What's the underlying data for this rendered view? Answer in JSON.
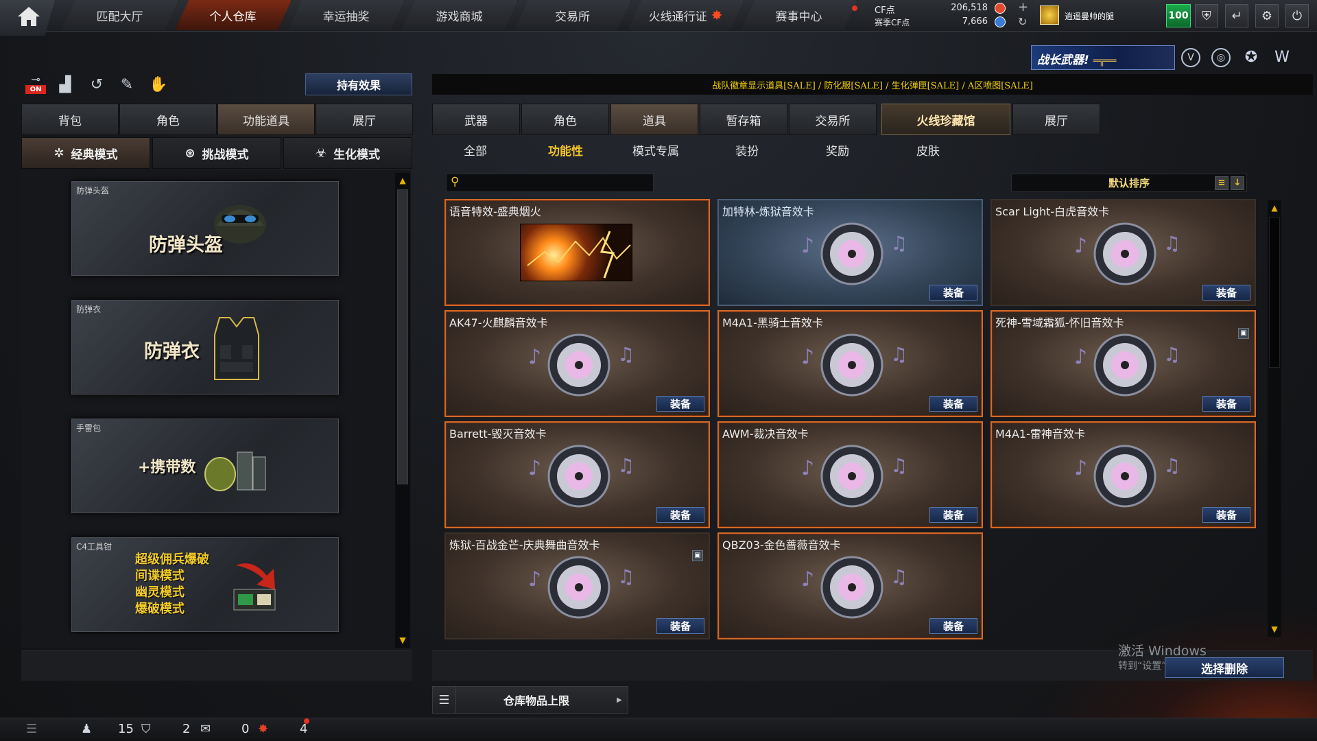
{
  "topbar": {
    "nav": [
      "匹配大厅",
      "个人仓库",
      "幸运抽奖",
      "游戏商城",
      "交易所",
      "火线通行证",
      "赛事中心"
    ],
    "active_nav": 1,
    "cf_label": "CF点",
    "cf_value": "206,518",
    "season_label": "赛季CF点",
    "season_value": "7,666",
    "player_name": "逍遥曼帅的腿",
    "level": "100",
    "banner_text": "战长武器!"
  },
  "left": {
    "effect_button": "持有效果",
    "on_label": "ON",
    "tabs": [
      "背包",
      "角色",
      "功能道具",
      "展厅"
    ],
    "active_tab": 2,
    "mode_tabs": [
      "经典模式",
      "挑战模式",
      "生化模式"
    ],
    "active_mode": 0,
    "cards": [
      {
        "caption": "防弹头盔",
        "title": "防弹头盔"
      },
      {
        "caption": "防弹衣",
        "title": "防弹衣"
      },
      {
        "caption": "手雷包",
        "title": "+携带数"
      },
      {
        "caption": "C4工具钳",
        "lines": [
          "超级佣兵爆破",
          "间谍模式",
          "幽灵模式",
          "爆破模式"
        ]
      }
    ]
  },
  "right": {
    "ticker": "战队徽章显示道具[SALE] / 防化服[SALE] / 生化弹匣[SALE] / A区喷图[SALE]",
    "tabs": [
      "武器",
      "角色",
      "道具",
      "暂存箱",
      "交易所",
      "火线珍藏馆",
      "展厅"
    ],
    "active_tab": 2,
    "subtabs": [
      "全部",
      "功能性",
      "模式专属",
      "装扮",
      "奖励",
      "皮肤"
    ],
    "active_subtab": 1,
    "search_placeholder": "",
    "sort_label": "默认排序",
    "equip_label": "装备",
    "items": [
      {
        "title": "语音特效-盛典烟火",
        "style": "sel",
        "fireworks": true,
        "equip": false
      },
      {
        "title": "加特林-炼狱音效卡",
        "style": "blue",
        "equip": true
      },
      {
        "title": "Scar Light-白虎音效卡",
        "style": "",
        "equip": true
      },
      {
        "title": "AK47-火麒麟音效卡",
        "style": "sel",
        "equip": true
      },
      {
        "title": "M4A1-黑骑士音效卡",
        "style": "sel",
        "equip": true
      },
      {
        "title": "死神-雪域霜狐-怀旧音效卡",
        "style": "sel",
        "equip": true,
        "lock": true
      },
      {
        "title": "Barrett-毁灭音效卡",
        "style": "sel",
        "equip": true
      },
      {
        "title": "AWM-裁决音效卡",
        "style": "sel",
        "equip": true
      },
      {
        "title": "M4A1-雷神音效卡",
        "style": "sel",
        "equip": true
      },
      {
        "title": "炼狱-百战金芒-庆典舞曲音效卡",
        "style": "",
        "equip": true,
        "lock": true
      },
      {
        "title": "QBZ03-金色蔷薇音效卡",
        "style": "sel",
        "equip": true
      }
    ],
    "storage_label": "仓库物品上限",
    "watermark_title": "激活 Windows",
    "watermark_sub": "转到“设置”以激活",
    "delete_label": "选择删除"
  },
  "statusbar": {
    "friends": "15",
    "messages": "2",
    "gifts": "0",
    "notices": "4"
  }
}
